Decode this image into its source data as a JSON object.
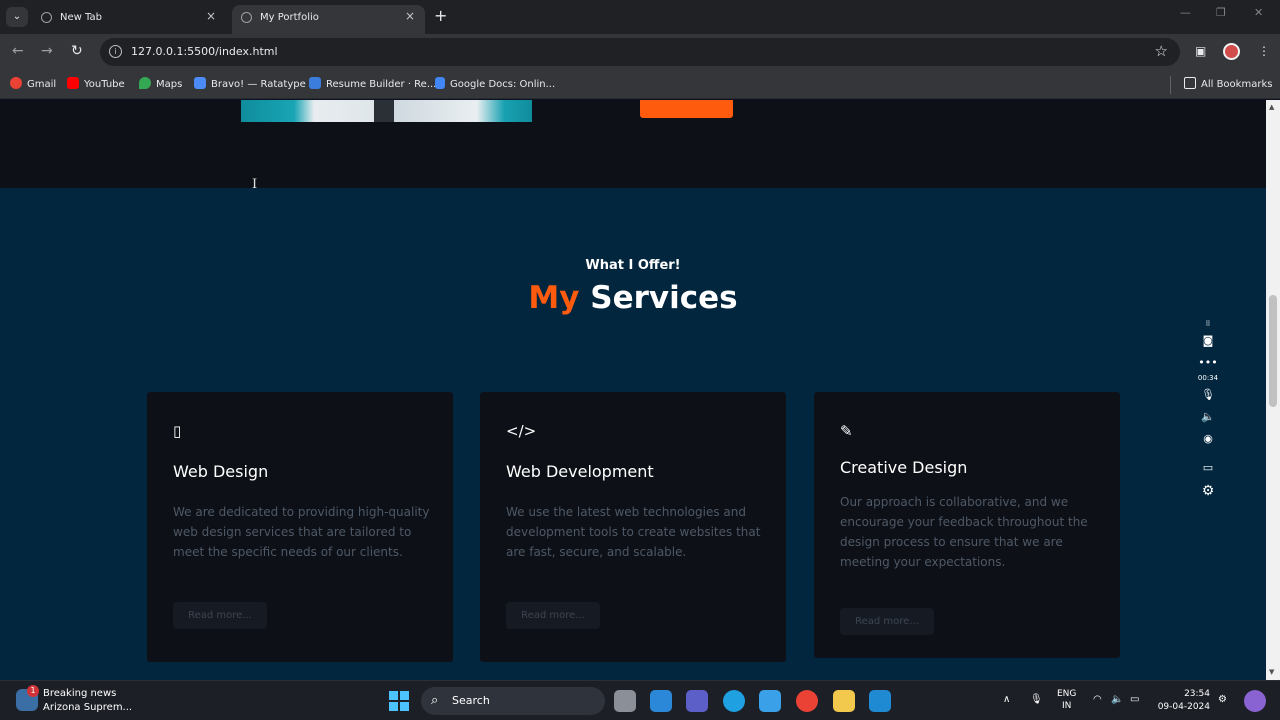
{
  "browser": {
    "tabs": [
      {
        "title": "New Tab",
        "active": false
      },
      {
        "title": "My Portfolio",
        "active": true
      }
    ],
    "new_tab_symbol": "+",
    "url": "127.0.0.1:5500/index.html",
    "bookmarks": [
      {
        "label": "Gmail",
        "color": "#ea4335"
      },
      {
        "label": "YouTube",
        "color": "#ff0000"
      },
      {
        "label": "Maps",
        "color": "#34a853"
      },
      {
        "label": "Bravo! — Ratatype",
        "color": "#4c8bf5"
      },
      {
        "label": "Resume Builder · Re...",
        "color": "#3b7ddd"
      },
      {
        "label": "Google Docs: Onlin...",
        "color": "#4285f4"
      }
    ],
    "all_bookmarks": "All Bookmarks"
  },
  "page": {
    "services": {
      "subheading": "What I Offer!",
      "heading_accent": "My",
      "heading_main": "Services",
      "accent_color": "#ff5b0f",
      "background": "#03263f",
      "cards": [
        {
          "icon": "mobile-icon",
          "icon_glyph": "▯",
          "title": "Web Design",
          "text": "We are dedicated to providing high-quality web design services that are tailored to meet the specific needs of our clients.",
          "button": "Read more..."
        },
        {
          "icon": "code-icon",
          "icon_glyph": "</>",
          "title": "Web Development",
          "text": "We use the latest web technologies and development tools to create websites that are fast, secure, and scalable.",
          "button": "Read more..."
        },
        {
          "icon": "pencil-icon",
          "icon_glyph": "✎",
          "title": "Creative Design",
          "text": "Our approach is collaborative, and we encourage your feedback throughout the design process to ensure that we are meeting your expectations.",
          "button": "Read more..."
        }
      ]
    }
  },
  "recorder": {
    "timer": "00:34"
  },
  "taskbar": {
    "news_badge": "1",
    "news_title": "Breaking news",
    "news_subtitle": "Arizona Suprem...",
    "search_label": "Search",
    "lang_line1": "ENG",
    "lang_line2": "IN",
    "time": "23:54",
    "date": "09-04-2024"
  }
}
